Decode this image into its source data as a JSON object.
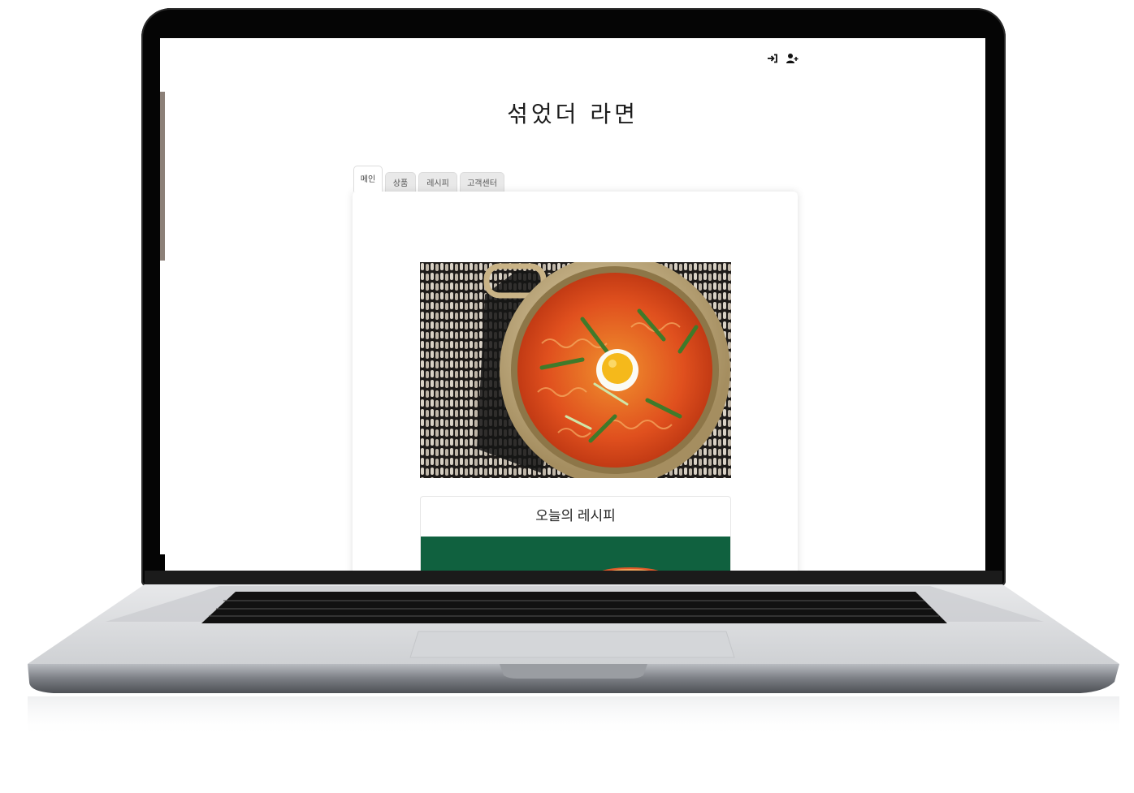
{
  "site": {
    "title": "섞었더 라면"
  },
  "header": {
    "icons": [
      "login-icon",
      "user-add-icon"
    ]
  },
  "tabs": [
    {
      "label": "메인",
      "active": true
    },
    {
      "label": "상품",
      "active": false
    },
    {
      "label": "레시피",
      "active": false
    },
    {
      "label": "고객센터",
      "active": false
    }
  ],
  "main": {
    "hero_image": "ramen-pot-photo",
    "recipe_section": {
      "title": "오늘의 레시피",
      "image": "recipe-photo"
    }
  },
  "colors": {
    "page_background": "#ffffff",
    "tab_inactive": "#e9e9e9",
    "recipe_image_green": "#10613f",
    "bezel": "#050505"
  }
}
